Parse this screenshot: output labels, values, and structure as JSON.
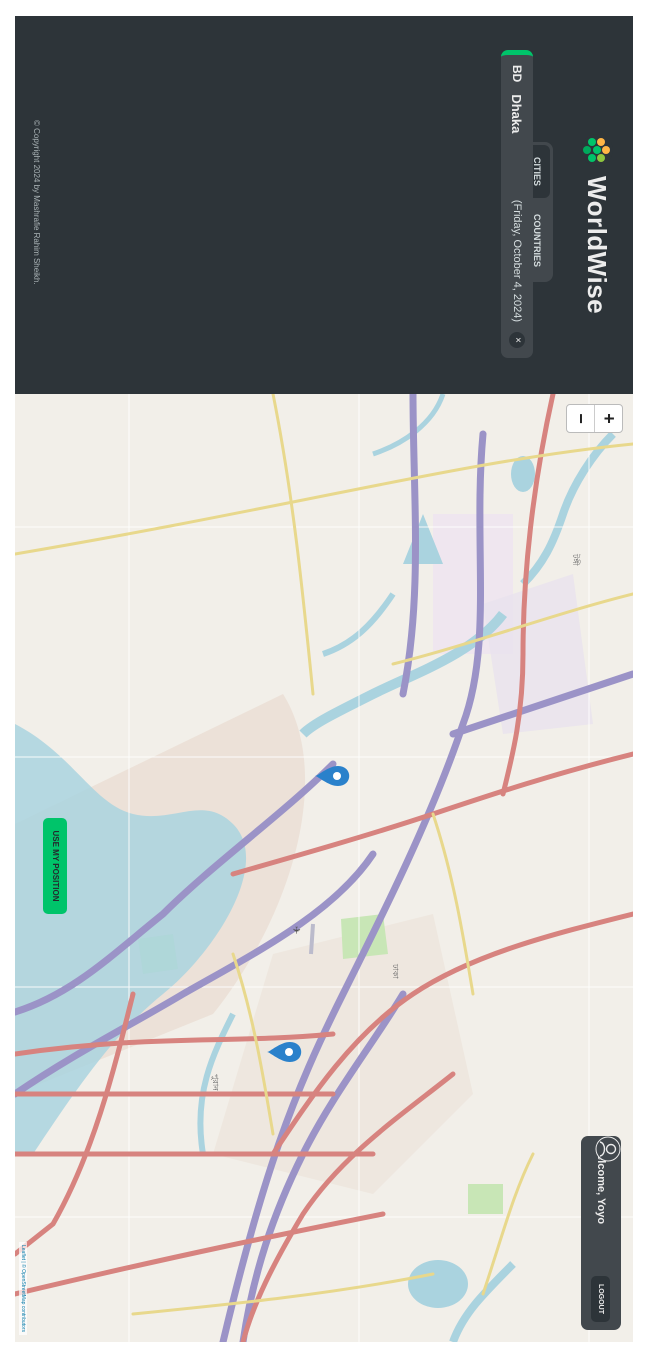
{
  "app": {
    "name": "WorldWise"
  },
  "tabs": [
    {
      "label": "CITIES",
      "active": true
    },
    {
      "label": "COUNTRIES",
      "active": false
    }
  ],
  "city_list": [
    {
      "flag": "BD",
      "name": "Dhaka",
      "date": "(Friday, October 4, 2024)",
      "delete_label": "×"
    }
  ],
  "footer": {
    "copyright": "© Copyright 2024 by Mashrafie Rahim Sheikh."
  },
  "map": {
    "zoom_in": "+",
    "zoom_out": "−",
    "use_position_label": "USE MY POSITION",
    "attribution_leaflet": "Leaflet",
    "attribution_rest": " | © OpenStreetMap contributors",
    "markers": 2,
    "colors": {
      "water": "#aad3df",
      "major_road": "#9b93c7",
      "arterial": "#d7837f",
      "accent": "#00c46a"
    }
  },
  "user": {
    "welcome": "Welcome, Yoyo",
    "logout_label": "LOGOUT"
  }
}
